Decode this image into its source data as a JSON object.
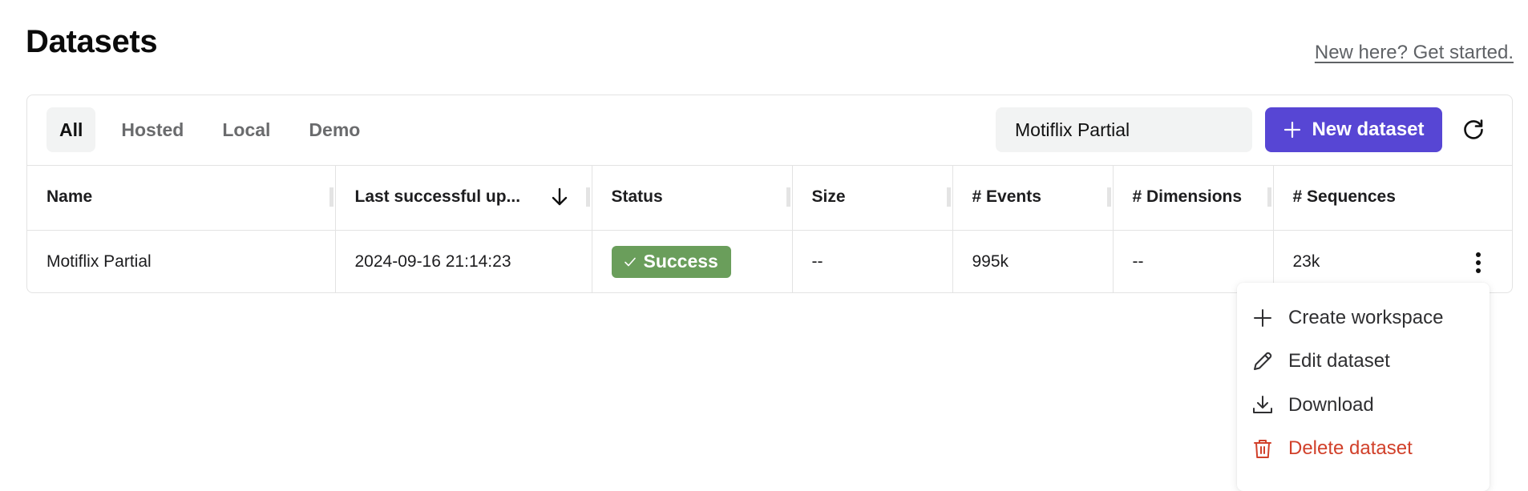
{
  "page": {
    "title": "Datasets",
    "get_started_link": "New here? Get started."
  },
  "toolbar": {
    "tabs": [
      {
        "label": "All",
        "active": true
      },
      {
        "label": "Hosted",
        "active": false
      },
      {
        "label": "Local",
        "active": false
      },
      {
        "label": "Demo",
        "active": false
      }
    ],
    "search_value": "Motiflix Partial",
    "new_dataset_label": "New dataset",
    "new_dataset_icon": "plus-icon",
    "refresh_icon": "refresh-icon",
    "accent_color": "#5746d4"
  },
  "table": {
    "columns": [
      {
        "label": "Name"
      },
      {
        "label": "Last successful up...",
        "sort": "descending"
      },
      {
        "label": "Status"
      },
      {
        "label": "Size"
      },
      {
        "label": "# Events"
      },
      {
        "label": "# Dimensions"
      },
      {
        "label": "# Sequences"
      }
    ],
    "rows": [
      {
        "name": "Motiflix Partial",
        "last_update": "2024-09-16 21:14:23",
        "status": "Success",
        "status_color": "#6a9e5b",
        "size": "--",
        "events": "995k",
        "dimensions": "--",
        "sequences": "23k"
      }
    ]
  },
  "row_menu": {
    "items": [
      {
        "label": "Create workspace",
        "icon": "plus-icon"
      },
      {
        "label": "Edit dataset",
        "icon": "pencil-icon"
      },
      {
        "label": "Download",
        "icon": "download-icon"
      },
      {
        "label": "Delete dataset",
        "icon": "trash-icon",
        "color": "#d1402a"
      }
    ]
  }
}
